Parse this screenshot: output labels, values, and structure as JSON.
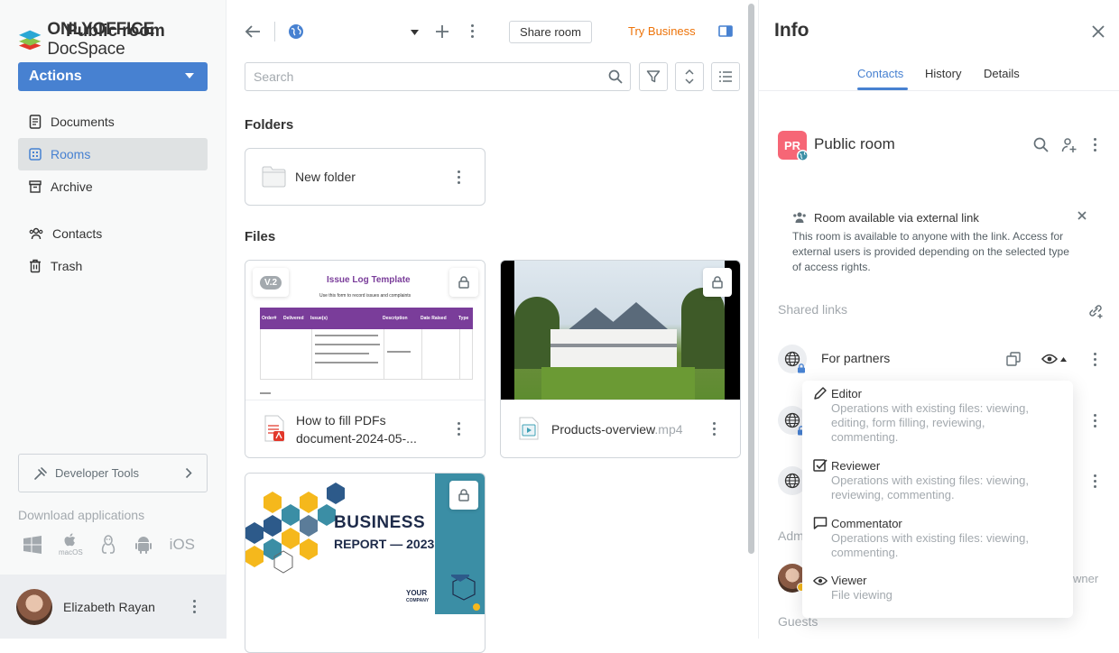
{
  "sidebar": {
    "logo_brand": "ONLYOFFICE",
    "logo_product": "DocSpace",
    "actions_label": "Actions",
    "nav": [
      {
        "label": "Documents"
      },
      {
        "label": "Rooms"
      },
      {
        "label": "Archive"
      },
      {
        "label": "Contacts"
      },
      {
        "label": "Trash"
      }
    ],
    "developer_tools_label": "Developer Tools",
    "download_label": "Download applications",
    "platforms": [
      "windows-icon",
      "macos-icon",
      "linux-icon",
      "android-icon",
      "ios-icon"
    ],
    "macos_label": "macOS",
    "ios_label": "iOS",
    "user_name": "Elizabeth Rayan"
  },
  "header": {
    "room_title": "Public room",
    "share_room_label": "Share room",
    "try_business_label": "Try Business"
  },
  "search": {
    "placeholder": "Search"
  },
  "main": {
    "folders_heading": "Folders",
    "files_heading": "Files",
    "folders": [
      {
        "name": "New folder"
      }
    ],
    "files": [
      {
        "name": "How to fill PDFs document-2024-05-...",
        "line1": "How to fill PDFs",
        "line2": "document-2024-05-...",
        "version": "V.2",
        "thumb_title": "Issue Log Template",
        "thumb_subtitle": "Use this form to record issues and complaints",
        "thumb_headers": [
          "Order#",
          "Delivered",
          "Issue(s)",
          "Description",
          "Date Raised",
          "Type"
        ]
      },
      {
        "name": "Products-overview",
        "ext": ".mp4"
      },
      {
        "thumb_title_1": "BUSINESS",
        "thumb_title_2": "REPORT — 2023",
        "thumb_your": "YOUR",
        "thumb_company": "COMPANY"
      }
    ]
  },
  "info": {
    "title": "Info",
    "tabs": [
      {
        "label": "Contacts"
      },
      {
        "label": "History"
      },
      {
        "label": "Details"
      }
    ],
    "active_tab": "Contacts",
    "room_initials": "PR",
    "room_name": "Public room",
    "notice_title": "Room available via external link",
    "notice_text": "This room is available to anyone with the link. Access for external users is provided depending on the selected type of access rights.",
    "shared_links_heading": "Shared links",
    "link_name": "For partners",
    "admins_partial": "Adm",
    "owner_partial": "wner",
    "guests_heading": "Guests"
  },
  "access_menu": [
    {
      "title": "Editor",
      "desc_1": "Operations with existing files: viewing,",
      "desc_2": "editing, form filling, reviewing,",
      "desc_3": "commenting."
    },
    {
      "title": "Reviewer",
      "desc_1": "Operations with existing files: viewing,",
      "desc_2": "reviewing, commenting."
    },
    {
      "title": "Commentator",
      "desc_1": "Operations with existing files: viewing,",
      "desc_2": "commenting."
    },
    {
      "title": "Viewer",
      "desc_1": "File viewing"
    }
  ],
  "colors": {
    "accent": "#4781d1",
    "try_business": "#ed7309",
    "room_logo": "#f66676"
  }
}
